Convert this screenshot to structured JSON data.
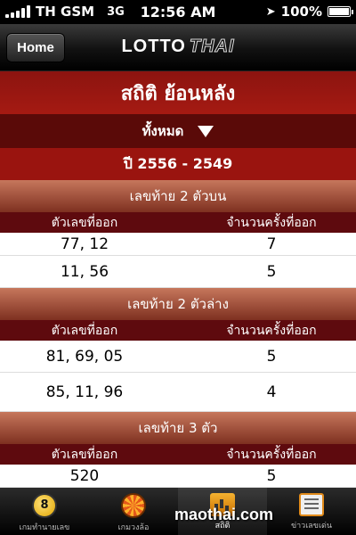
{
  "status_bar": {
    "carrier": "TH GSM",
    "network": "3G",
    "time": "12:56 AM",
    "battery": "100%",
    "battery_level": 1.0
  },
  "nav_bar": {
    "home_label": "Home",
    "logo_main": "LOTTO",
    "logo_accent": "THAI"
  },
  "title": "สถิติ ย้อนหลัง",
  "filter_label": "ทั้งหมด",
  "year_range": "ปี 2556 - 2549",
  "columns": {
    "numbers": "ตัวเลขที่ออก",
    "count": "จำนวนครั้งที่ออก"
  },
  "sections": [
    {
      "title": "เลขท้าย 2 ตัวบน",
      "rows": [
        {
          "numbers": "77, 12",
          "count": "7"
        },
        {
          "numbers": "11, 56",
          "count": "5"
        }
      ]
    },
    {
      "title": "เลขท้าย 2 ตัวล่าง",
      "rows": [
        {
          "numbers": "81, 69, 05",
          "count": "5"
        },
        {
          "numbers": "85, 11, 96",
          "count": "4"
        }
      ]
    },
    {
      "title": "เลขท้าย 3 ตัว",
      "rows": [
        {
          "numbers": "520",
          "count": "5"
        }
      ]
    }
  ],
  "tabs": [
    {
      "label": "เกมทำนายเลข",
      "icon": "lottery-balls-icon"
    },
    {
      "label": "เกมวงล้อ",
      "icon": "wheel-icon"
    },
    {
      "label": "สถิติ",
      "icon": "chart-icon"
    },
    {
      "label": "ข่าวเลขเด่น",
      "icon": "news-icon"
    }
  ],
  "watermark": "maothai.com"
}
